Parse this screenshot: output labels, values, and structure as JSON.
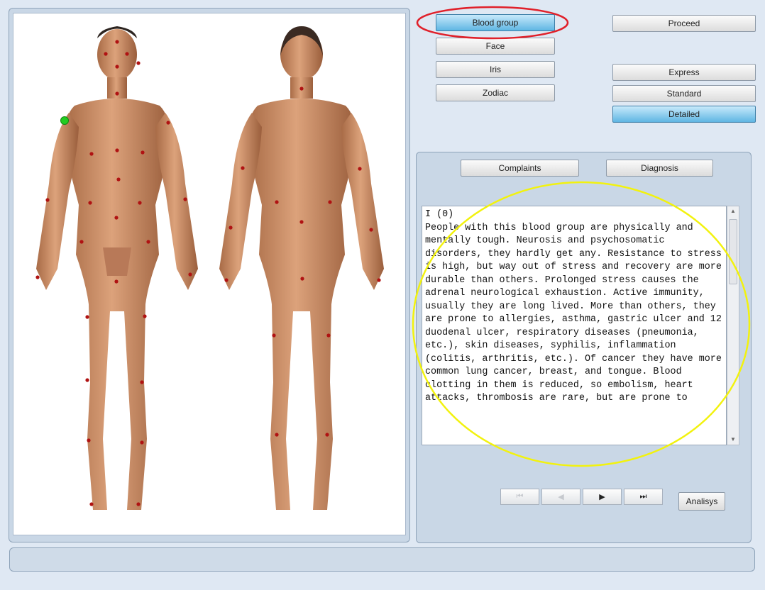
{
  "top_buttons": {
    "blood_group": "Blood group",
    "face": "Face",
    "iris": "Iris",
    "zodiac": "Zodiac",
    "proceed": "Proceed",
    "express": "Express",
    "standard": "Standard",
    "detailed": "Detailed"
  },
  "tabs": {
    "complaints": "Complaints",
    "diagnosis": "Diagnosis"
  },
  "description": {
    "text": "I (0)\nPeople with this blood group are physically and mentally tough. Neurosis and psychosomatic disorders, they hardly get any. Resistance to stress is high, but way out of stress and recovery are more durable than others. Prolonged stress causes the adrenal neurological exhaustion. Active immunity, usually they are long lived. More than others, they are prone to allergies, asthma, gastric ulcer and 12 duodenal ulcer, respiratory diseases (pneumonia, etc.), skin diseases, syphilis, inflammation (colitis, arthritis, etc.). Of cancer they have more common lung cancer, breast, and tongue. Blood clotting in them is reduced, so embolism, heart attacks, thrombosis are rare, but are prone to"
  },
  "player": {
    "analysis_label": "Analisys"
  },
  "icons": {
    "rewind": "rewind-icon",
    "back": "step-back-icon",
    "play": "play-icon",
    "skip_end": "skip-end-icon"
  },
  "colors": {
    "selected_button": "#5fb6e3",
    "point": "#b01212",
    "active_point": "#22cc22",
    "red_annotation": "#e0202a",
    "yellow_annotation": "#f2f20e"
  }
}
